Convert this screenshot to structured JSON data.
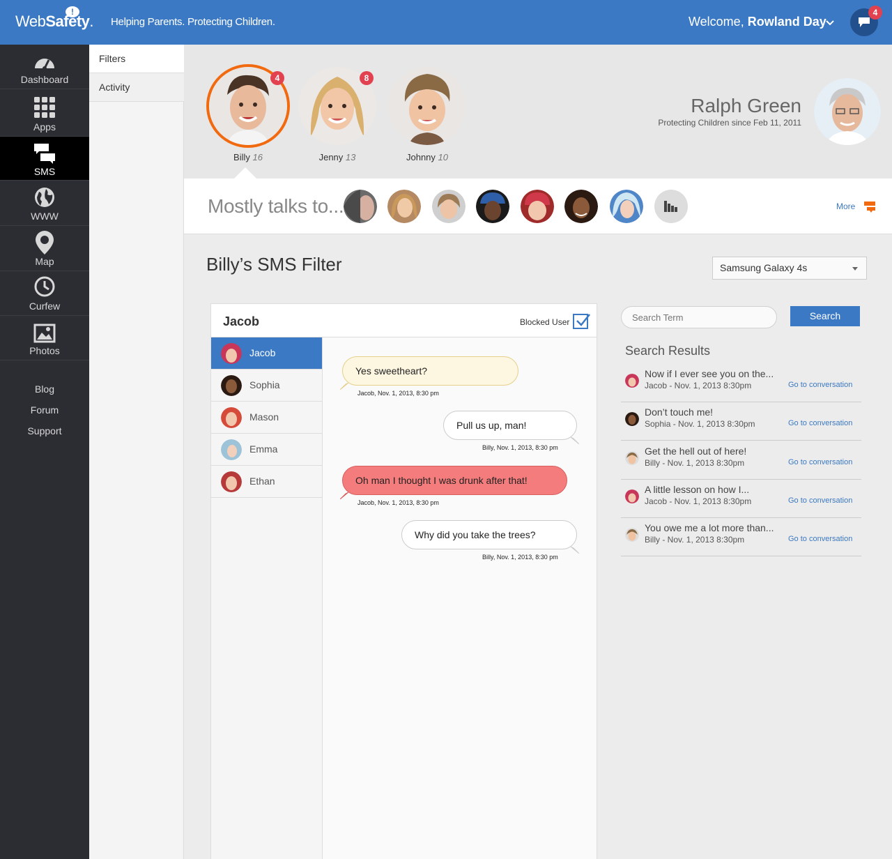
{
  "header": {
    "logo_part1": "Web",
    "logo_part2": "Safety",
    "logo_dot": ".",
    "tagline": "Helping Parents. Protecting Children.",
    "welcome_prefix": "Welcome,",
    "welcome_user": "Rowland Day",
    "notification_count": "4",
    "brand_color": "#3b79c4"
  },
  "sidebar": {
    "items": [
      {
        "label": "Dashboard",
        "icon": "gauge-icon"
      },
      {
        "label": "Apps",
        "icon": "grid-icon"
      },
      {
        "label": "SMS",
        "icon": "chat-bubbles-icon"
      },
      {
        "label": "WWW",
        "icon": "globe-icon"
      },
      {
        "label": "Map",
        "icon": "map-pin-icon"
      },
      {
        "label": "Curfew",
        "icon": "clock-icon"
      },
      {
        "label": "Photos",
        "icon": "image-icon"
      }
    ],
    "links": [
      "Blog",
      "Forum",
      "Support"
    ]
  },
  "subnav": {
    "items": [
      "Filters",
      "Activity"
    ]
  },
  "children": [
    {
      "name": "Billy",
      "age": "16",
      "badge": "4"
    },
    {
      "name": "Jenny",
      "age": "13",
      "badge": "8"
    },
    {
      "name": "Johnny",
      "age": "10",
      "badge": ""
    }
  ],
  "parent": {
    "name": "Ralph Green",
    "since": "Protecting Children since  Feb 11, 2011"
  },
  "talks": {
    "title": "Mostly talks to...",
    "more": "More"
  },
  "page": {
    "title": "Billy’s SMS Filter",
    "device": "Samsung Galaxy 4s"
  },
  "conversation": {
    "name": "Jacob",
    "blocked_label": "Blocked User",
    "contacts": [
      "Jacob",
      "Sophia",
      "Mason",
      "Emma",
      "Ethan"
    ],
    "messages": [
      {
        "text": "Yes sweetheart?",
        "meta": "Jacob, Nov. 1, 2013, 8:30 pm"
      },
      {
        "text": "Pull us up, man!",
        "meta": "Billy, Nov. 1, 2013, 8:30 pm"
      },
      {
        "text": "Oh man I thought I was drunk after that!",
        "meta": "Jacob, Nov. 1, 2013, 8:30 pm"
      },
      {
        "text": "Why did you take the trees?",
        "meta": "Billy, Nov. 1, 2013, 8:30 pm"
      }
    ]
  },
  "search": {
    "placeholder": "Search Term",
    "button": "Search",
    "results_title": "Search Results",
    "link_label": "Go to conversation",
    "results": [
      {
        "text": "Now if I ever see you on  the...",
        "meta": "Jacob - Nov. 1, 2013 8:30pm"
      },
      {
        "text": "Don’t touch me!",
        "meta": "Sophia - Nov. 1, 2013 8:30pm"
      },
      {
        "text": "Get the hell out of here!",
        "meta": "Billy - Nov. 1, 2013 8:30pm"
      },
      {
        "text": "A little lesson on how I...",
        "meta": "Jacob - Nov. 1, 2013 8:30pm"
      },
      {
        "text": "You owe me a lot more than...",
        "meta": "Billy - Nov. 1, 2013 8:30pm"
      }
    ]
  }
}
